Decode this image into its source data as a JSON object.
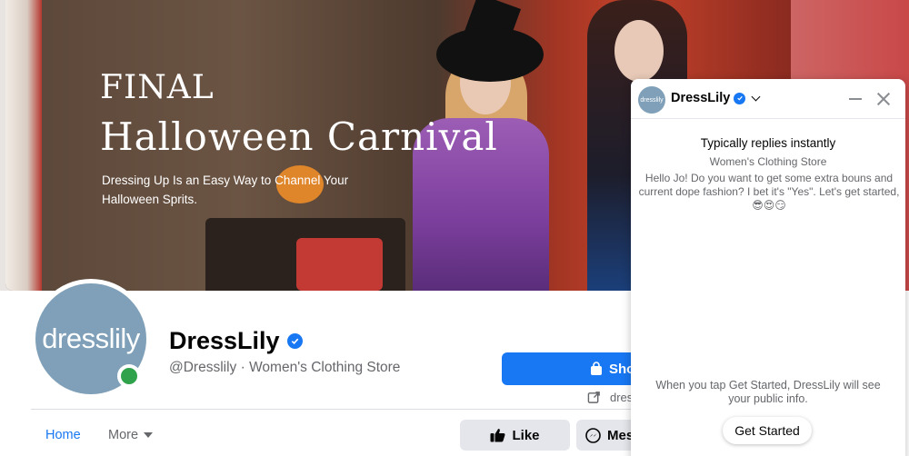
{
  "cover": {
    "title_line1": "FINAL",
    "title_line2": "Halloween Carnival",
    "subtitle": "Dressing Up Is an Easy Way to Channel Your Halloween Sprits."
  },
  "profile": {
    "avatar_text": "dresslily",
    "name": "DressLily",
    "handle": "@Dresslily · Women's Clothing Store",
    "status": "online"
  },
  "actions": {
    "shop_label": "Sho",
    "link_text": "dres",
    "like_label": "Like",
    "message_label": "Mes"
  },
  "tabs": [
    {
      "label": "Home",
      "active": true
    },
    {
      "label": "More",
      "active": false
    }
  ],
  "chat": {
    "avatar_text": "dresslily",
    "name": "DressLily",
    "replies": "Typically replies instantly",
    "category": "Women's Clothing Store",
    "message": "Hello Jo! Do you want to get some extra bouns and current dope fashion? I bet it's \"Yes\". Let's get started, 😎😍😏",
    "info": "When you tap Get Started, DressLily will see your public info.",
    "get_started_label": "Get Started"
  },
  "colors": {
    "brand_blue": "#1877f2",
    "online_green": "#31a24c",
    "avatar_bg": "#7fa0b8"
  },
  "icons": [
    "verified-badge-icon",
    "shopping-bag-icon",
    "external-link-icon",
    "thumbs-up-icon",
    "messenger-icon",
    "chevron-down-icon",
    "minimize-icon",
    "close-icon",
    "caret-down-icon"
  ]
}
